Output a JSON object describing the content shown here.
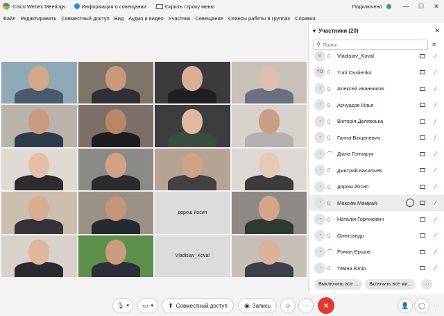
{
  "titlebar": {
    "app_name": "Cisco Webex Meetings",
    "meeting_info": "Информация о совещании",
    "hide_menu": "Скрыть строку меню",
    "status": "Подключено",
    "status_color": "#2ba84a",
    "minimize": "—",
    "maximize": "☐",
    "close": "✕"
  },
  "menu": [
    "Файл",
    "Редактировать",
    "Совместный доступ",
    "Вид",
    "Аудио и видео",
    "Участник",
    "Совещание",
    "Сеансы работы в группах",
    "Справка"
  ],
  "grid": {
    "tiles": [
      {
        "type": "video",
        "bg": "#8fa9b6",
        "skin": "#d6a88a",
        "shirt": "#4a5a6a"
      },
      {
        "type": "video",
        "bg": "#7f7468",
        "skin": "#c8997d",
        "shirt": "#2f2f35"
      },
      {
        "type": "video",
        "bg": "#3b3b3d",
        "skin": "#d9b095",
        "shirt": "#1f1f22"
      },
      {
        "type": "video",
        "bg": "#c8c1ba",
        "skin": "#dcbfae",
        "shirt": "#6a7080"
      },
      {
        "type": "video",
        "bg": "#b9b3aa",
        "skin": "#c99a7d",
        "shirt": "#2d3b4a"
      },
      {
        "type": "video",
        "bg": "#7b6f67",
        "skin": "#b78767",
        "shirt": "#1d1d1d"
      },
      {
        "type": "video",
        "bg": "#3a3c3e",
        "skin": "#e0b99f",
        "shirt": "#3a4d3a"
      },
      {
        "type": "video",
        "bg": "#d7d2cc",
        "skin": "#c89f85",
        "shirt": "#b4b2b0"
      },
      {
        "type": "video",
        "bg": "#e1dad2",
        "skin": "#e2c0a8",
        "shirt": "#2e2c2f"
      },
      {
        "type": "video",
        "bg": "#8c8a87",
        "skin": "#d0a386",
        "shirt": "#2b2a2d"
      },
      {
        "type": "video",
        "bg": "#b5a494",
        "skin": "#cfa487",
        "shirt": "#444040"
      },
      {
        "type": "video",
        "bg": "#ddd8d4",
        "skin": "#e6cab5",
        "shirt": "#3c3c3c"
      },
      {
        "type": "video",
        "bg": "#cdbfae",
        "skin": "#d8ad91",
        "shirt": "#35333a"
      },
      {
        "type": "video",
        "bg": "#9c9186",
        "skin": "#c49579",
        "shirt": "#252a30"
      },
      {
        "type": "name",
        "label": "дорош йосип"
      },
      {
        "type": "video",
        "bg": "#8d8a86",
        "skin": "#d3a58a",
        "shirt": "#2f3a30"
      },
      {
        "type": "video",
        "bg": "#d8d2cb",
        "skin": "#e0b79c",
        "shirt": "#2a2a2e"
      },
      {
        "type": "video",
        "bg": "#5c8f4a",
        "skin": "#c99b7f",
        "shirt": "#2a2f3a"
      },
      {
        "type": "name",
        "label": "Vladislav_Koval"
      },
      {
        "type": "video",
        "bg": "#c7c0b7",
        "skin": "#d9b39a",
        "shirt": "#3a3f48"
      }
    ]
  },
  "participants_panel": {
    "title": "Участники (20)",
    "close": "✕",
    "search_placeholder": "Поиск",
    "participants": [
      {
        "initials": "V",
        "name": "Vladislav_Koval",
        "device": "phone",
        "highlighted": false
      },
      {
        "initials": "YO",
        "name": "Yurii Ovsiienko",
        "device": "phone",
        "highlighted": false
      },
      {
        "initials": "",
        "name": "Алексей иванников",
        "device": "phone",
        "highlighted": false
      },
      {
        "initials": "",
        "name": "Арчуадзе Илья",
        "device": "phone",
        "highlighted": false
      },
      {
        "initials": "",
        "name": "Вікторія Делявська",
        "device": "phone",
        "highlighted": false
      },
      {
        "initials": "",
        "name": "Ганна Вінцелевич",
        "device": "phone",
        "highlighted": false
      },
      {
        "initials": "",
        "name": "Діана Гончарук",
        "device": "headset",
        "highlighted": false
      },
      {
        "initials": "",
        "name": "дмитрий васильев",
        "device": "phone",
        "highlighted": false
      },
      {
        "initials": "",
        "name": "дорош йосип",
        "device": "phone",
        "highlighted": false
      },
      {
        "initials": "",
        "name": "Максим Мамрай",
        "device": "phone",
        "highlighted": true
      },
      {
        "initials": "",
        "name": "Наталія Горпіневич",
        "device": "phone",
        "highlighted": false
      },
      {
        "initials": "",
        "name": "Олександр",
        "device": "phone",
        "highlighted": false
      },
      {
        "initials": "",
        "name": "Роман Єршов",
        "device": "headset",
        "highlighted": false
      },
      {
        "initials": "",
        "name": "Темна Юлія",
        "device": "phone",
        "highlighted": false
      }
    ],
    "mute_all": "Выключить все ...",
    "mute_all_video": "Включить все ми...",
    "more": "···"
  },
  "controls": {
    "share_label": "Совместный доступ",
    "record_label": "Запись",
    "end_color": "#e0372f"
  }
}
